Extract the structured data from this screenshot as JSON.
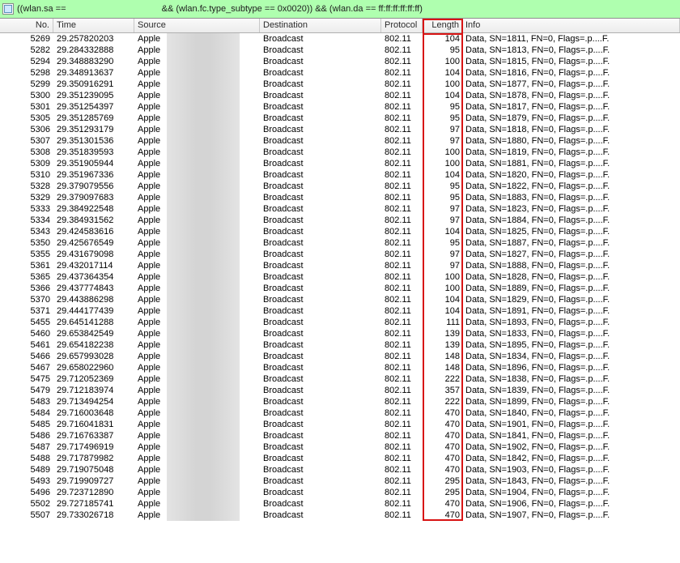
{
  "filter": {
    "prefix": "((wlan.sa == ",
    "suffix": " && (wlan.fc.type_subtype == 0x0020)) && (wlan.da == ff:ff:ff:ff:ff:ff)"
  },
  "columns": {
    "no": "No.",
    "time": "Time",
    "source": "Source",
    "destination": "Destination",
    "protocol": "Protocol",
    "length": "Length",
    "info": "Info"
  },
  "rows": [
    {
      "no": 5269,
      "time": "29.257820203",
      "src": "Apple",
      "dest": "Broadcast",
      "proto": "802.11",
      "len": 104,
      "info": "Data, SN=1811, FN=0, Flags=.p....F."
    },
    {
      "no": 5282,
      "time": "29.284332888",
      "src": "Apple",
      "dest": "Broadcast",
      "proto": "802.11",
      "len": 95,
      "info": "Data, SN=1813, FN=0, Flags=.p....F."
    },
    {
      "no": 5294,
      "time": "29.348883290",
      "src": "Apple",
      "dest": "Broadcast",
      "proto": "802.11",
      "len": 100,
      "info": "Data, SN=1815, FN=0, Flags=.p....F."
    },
    {
      "no": 5298,
      "time": "29.348913637",
      "src": "Apple",
      "dest": "Broadcast",
      "proto": "802.11",
      "len": 104,
      "info": "Data, SN=1816, FN=0, Flags=.p....F."
    },
    {
      "no": 5299,
      "time": "29.350916291",
      "src": "Apple",
      "dest": "Broadcast",
      "proto": "802.11",
      "len": 100,
      "info": "Data, SN=1877, FN=0, Flags=.p....F."
    },
    {
      "no": 5300,
      "time": "29.351239095",
      "src": "Apple",
      "dest": "Broadcast",
      "proto": "802.11",
      "len": 104,
      "info": "Data, SN=1878, FN=0, Flags=.p....F."
    },
    {
      "no": 5301,
      "time": "29.351254397",
      "src": "Apple",
      "dest": "Broadcast",
      "proto": "802.11",
      "len": 95,
      "info": "Data, SN=1817, FN=0, Flags=.p....F."
    },
    {
      "no": 5305,
      "time": "29.351285769",
      "src": "Apple",
      "dest": "Broadcast",
      "proto": "802.11",
      "len": 95,
      "info": "Data, SN=1879, FN=0, Flags=.p....F."
    },
    {
      "no": 5306,
      "time": "29.351293179",
      "src": "Apple",
      "dest": "Broadcast",
      "proto": "802.11",
      "len": 97,
      "info": "Data, SN=1818, FN=0, Flags=.p....F."
    },
    {
      "no": 5307,
      "time": "29.351301536",
      "src": "Apple",
      "dest": "Broadcast",
      "proto": "802.11",
      "len": 97,
      "info": "Data, SN=1880, FN=0, Flags=.p....F."
    },
    {
      "no": 5308,
      "time": "29.351839593",
      "src": "Apple",
      "dest": "Broadcast",
      "proto": "802.11",
      "len": 100,
      "info": "Data, SN=1819, FN=0, Flags=.p....F."
    },
    {
      "no": 5309,
      "time": "29.351905944",
      "src": "Apple",
      "dest": "Broadcast",
      "proto": "802.11",
      "len": 100,
      "info": "Data, SN=1881, FN=0, Flags=.p....F."
    },
    {
      "no": 5310,
      "time": "29.351967336",
      "src": "Apple",
      "dest": "Broadcast",
      "proto": "802.11",
      "len": 104,
      "info": "Data, SN=1820, FN=0, Flags=.p....F."
    },
    {
      "no": 5328,
      "time": "29.379079556",
      "src": "Apple",
      "dest": "Broadcast",
      "proto": "802.11",
      "len": 95,
      "info": "Data, SN=1822, FN=0, Flags=.p....F."
    },
    {
      "no": 5329,
      "time": "29.379097683",
      "src": "Apple",
      "dest": "Broadcast",
      "proto": "802.11",
      "len": 95,
      "info": "Data, SN=1883, FN=0, Flags=.p....F."
    },
    {
      "no": 5333,
      "time": "29.384922548",
      "src": "Apple",
      "dest": "Broadcast",
      "proto": "802.11",
      "len": 97,
      "info": "Data, SN=1823, FN=0, Flags=.p....F."
    },
    {
      "no": 5334,
      "time": "29.384931562",
      "src": "Apple",
      "dest": "Broadcast",
      "proto": "802.11",
      "len": 97,
      "info": "Data, SN=1884, FN=0, Flags=.p....F."
    },
    {
      "no": 5343,
      "time": "29.424583616",
      "src": "Apple",
      "dest": "Broadcast",
      "proto": "802.11",
      "len": 104,
      "info": "Data, SN=1825, FN=0, Flags=.p....F."
    },
    {
      "no": 5350,
      "time": "29.425676549",
      "src": "Apple",
      "dest": "Broadcast",
      "proto": "802.11",
      "len": 95,
      "info": "Data, SN=1887, FN=0, Flags=.p....F."
    },
    {
      "no": 5355,
      "time": "29.431679098",
      "src": "Apple",
      "dest": "Broadcast",
      "proto": "802.11",
      "len": 97,
      "info": "Data, SN=1827, FN=0, Flags=.p....F."
    },
    {
      "no": 5361,
      "time": "29.432017114",
      "src": "Apple",
      "dest": "Broadcast",
      "proto": "802.11",
      "len": 97,
      "info": "Data, SN=1888, FN=0, Flags=.p....F."
    },
    {
      "no": 5365,
      "time": "29.437364354",
      "src": "Apple",
      "dest": "Broadcast",
      "proto": "802.11",
      "len": 100,
      "info": "Data, SN=1828, FN=0, Flags=.p....F."
    },
    {
      "no": 5366,
      "time": "29.437774843",
      "src": "Apple",
      "dest": "Broadcast",
      "proto": "802.11",
      "len": 100,
      "info": "Data, SN=1889, FN=0, Flags=.p....F."
    },
    {
      "no": 5370,
      "time": "29.443886298",
      "src": "Apple",
      "dest": "Broadcast",
      "proto": "802.11",
      "len": 104,
      "info": "Data, SN=1829, FN=0, Flags=.p....F."
    },
    {
      "no": 5371,
      "time": "29.444177439",
      "src": "Apple",
      "dest": "Broadcast",
      "proto": "802.11",
      "len": 104,
      "info": "Data, SN=1891, FN=0, Flags=.p....F."
    },
    {
      "no": 5455,
      "time": "29.645141288",
      "src": "Apple",
      "dest": "Broadcast",
      "proto": "802.11",
      "len": 111,
      "info": "Data, SN=1893, FN=0, Flags=.p....F."
    },
    {
      "no": 5460,
      "time": "29.653842549",
      "src": "Apple",
      "dest": "Broadcast",
      "proto": "802.11",
      "len": 139,
      "info": "Data, SN=1833, FN=0, Flags=.p....F."
    },
    {
      "no": 5461,
      "time": "29.654182238",
      "src": "Apple",
      "dest": "Broadcast",
      "proto": "802.11",
      "len": 139,
      "info": "Data, SN=1895, FN=0, Flags=.p....F."
    },
    {
      "no": 5466,
      "time": "29.657993028",
      "src": "Apple",
      "dest": "Broadcast",
      "proto": "802.11",
      "len": 148,
      "info": "Data, SN=1834, FN=0, Flags=.p....F."
    },
    {
      "no": 5467,
      "time": "29.658022960",
      "src": "Apple",
      "dest": "Broadcast",
      "proto": "802.11",
      "len": 148,
      "info": "Data, SN=1896, FN=0, Flags=.p....F."
    },
    {
      "no": 5475,
      "time": "29.712052369",
      "src": "Apple",
      "dest": "Broadcast",
      "proto": "802.11",
      "len": 222,
      "info": "Data, SN=1838, FN=0, Flags=.p....F."
    },
    {
      "no": 5479,
      "time": "29.712183974",
      "src": "Apple",
      "dest": "Broadcast",
      "proto": "802.11",
      "len": 357,
      "info": "Data, SN=1839, FN=0, Flags=.p....F."
    },
    {
      "no": 5483,
      "time": "29.713494254",
      "src": "Apple",
      "dest": "Broadcast",
      "proto": "802.11",
      "len": 222,
      "info": "Data, SN=1899, FN=0, Flags=.p....F."
    },
    {
      "no": 5484,
      "time": "29.716003648",
      "src": "Apple",
      "dest": "Broadcast",
      "proto": "802.11",
      "len": 470,
      "info": "Data, SN=1840, FN=0, Flags=.p....F."
    },
    {
      "no": 5485,
      "time": "29.716041831",
      "src": "Apple",
      "dest": "Broadcast",
      "proto": "802.11",
      "len": 470,
      "info": "Data, SN=1901, FN=0, Flags=.p....F."
    },
    {
      "no": 5486,
      "time": "29.716763387",
      "src": "Apple",
      "dest": "Broadcast",
      "proto": "802.11",
      "len": 470,
      "info": "Data, SN=1841, FN=0, Flags=.p....F."
    },
    {
      "no": 5487,
      "time": "29.717496919",
      "src": "Apple",
      "dest": "Broadcast",
      "proto": "802.11",
      "len": 470,
      "info": "Data, SN=1902, FN=0, Flags=.p....F."
    },
    {
      "no": 5488,
      "time": "29.717879982",
      "src": "Apple",
      "dest": "Broadcast",
      "proto": "802.11",
      "len": 470,
      "info": "Data, SN=1842, FN=0, Flags=.p....F."
    },
    {
      "no": 5489,
      "time": "29.719075048",
      "src": "Apple",
      "dest": "Broadcast",
      "proto": "802.11",
      "len": 470,
      "info": "Data, SN=1903, FN=0, Flags=.p....F."
    },
    {
      "no": 5493,
      "time": "29.719909727",
      "src": "Apple",
      "dest": "Broadcast",
      "proto": "802.11",
      "len": 295,
      "info": "Data, SN=1843, FN=0, Flags=.p....F."
    },
    {
      "no": 5496,
      "time": "29.723712890",
      "src": "Apple",
      "dest": "Broadcast",
      "proto": "802.11",
      "len": 295,
      "info": "Data, SN=1904, FN=0, Flags=.p....F."
    },
    {
      "no": 5502,
      "time": "29.727185741",
      "src": "Apple",
      "dest": "Broadcast",
      "proto": "802.11",
      "len": 470,
      "info": "Data, SN=1906, FN=0, Flags=.p....F."
    },
    {
      "no": 5507,
      "time": "29.733026718",
      "src": "Apple",
      "dest": "Broadcast",
      "proto": "802.11",
      "len": 470,
      "info": "Data, SN=1907, FN=0, Flags=.p....F."
    }
  ]
}
